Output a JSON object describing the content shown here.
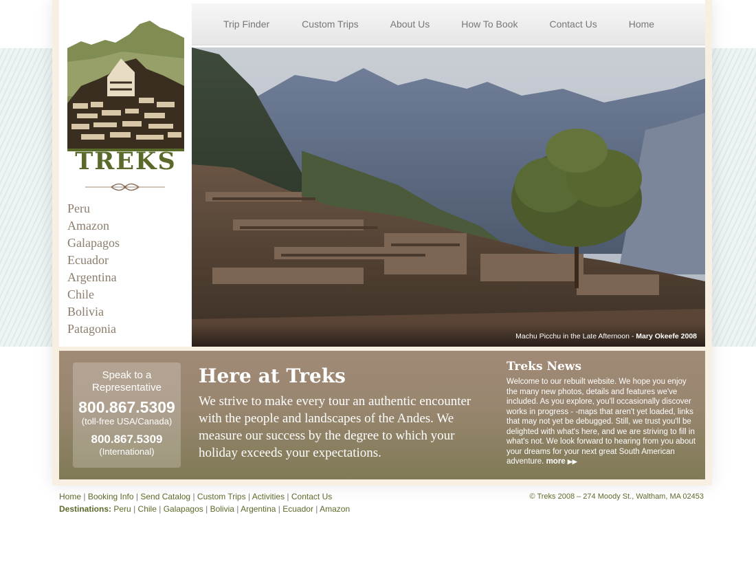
{
  "brand": {
    "name": "TREKS"
  },
  "nav": {
    "items": [
      {
        "label": "Trip Finder"
      },
      {
        "label": "Custom Trips"
      },
      {
        "label": "About Us"
      },
      {
        "label": "How To Book"
      },
      {
        "label": "Contact Us"
      },
      {
        "label": "Home"
      }
    ]
  },
  "sidebar": {
    "destinations": [
      {
        "label": "Peru"
      },
      {
        "label": "Amazon"
      },
      {
        "label": "Galapagos"
      },
      {
        "label": "Ecuador"
      },
      {
        "label": "Argentina"
      },
      {
        "label": "Chile"
      },
      {
        "label": "Bolivia"
      },
      {
        "label": "Patagonia"
      }
    ]
  },
  "hero": {
    "caption": "Machu Picchu in the Late Afternoon - ",
    "credit": "Mary Okeefe 2008"
  },
  "representative": {
    "title_line1": "Speak to a",
    "title_line2": "Representative",
    "phone_tollfree": "800.867.5309",
    "tollfree_note": "(toll-free USA/Canada)",
    "phone_intl": "800.867.5309",
    "intl_note": "(International)"
  },
  "intro": {
    "title": "Here at Treks",
    "text": "We strive to make every tour an authentic encounter with the people and landscapes of the Andes.  We measure our success by the degree to which your holiday exceeds your expectations."
  },
  "news": {
    "title": "Treks News",
    "text": "Welcome to our rebuilt website. We hope you enjoy the many new photos, details and features we've included. As you explore, you'll occasionally discover works in progress - -maps that aren't yet loaded, links that may not yet be debugged. Still, we trust you'll be delighted with what's here, and we are striving to fill in what's not. We look forward to hearing from you about your dreams for your next great South American adventure.",
    "more_label": "more"
  },
  "footer": {
    "links": [
      {
        "label": "Home"
      },
      {
        "label": "Booking Info"
      },
      {
        "label": "Send Catalog"
      },
      {
        "label": "Custom Trips"
      },
      {
        "label": "Activities"
      },
      {
        "label": "Contact Us"
      }
    ],
    "destinations_label": "Destinations:",
    "destinations": [
      {
        "label": "Peru"
      },
      {
        "label": "Chile"
      },
      {
        "label": "Galapagos"
      },
      {
        "label": "Bolivia"
      },
      {
        "label": "Argentina"
      },
      {
        "label": "Ecuador"
      },
      {
        "label": "Amazon"
      }
    ],
    "copyright": "© Treks 2008 – 274 Moody St., Waltham, MA 02453"
  },
  "colors": {
    "brand_green": "#5a6a2b",
    "panel_brown": "#98866f",
    "nav_text": "#777777"
  }
}
